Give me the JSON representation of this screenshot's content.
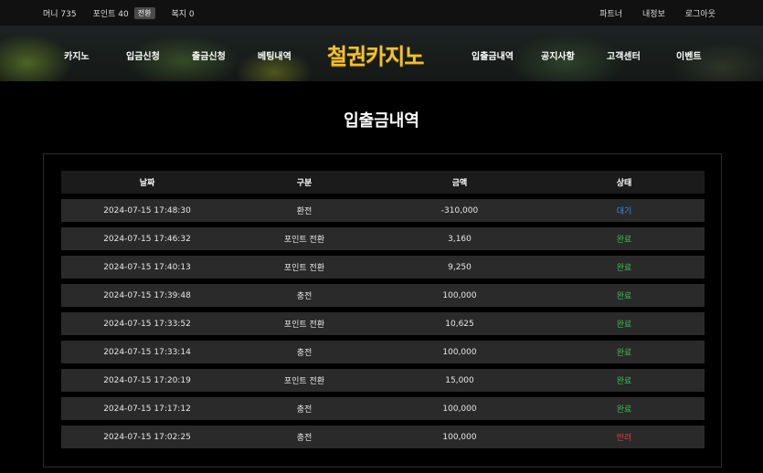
{
  "topbar": {
    "money_label": "머니 735",
    "point_label": "포인트 40",
    "convert_badge": "전환",
    "lottery_label": "복지 0",
    "links": [
      "파트너",
      "내정보",
      "로그아웃"
    ]
  },
  "nav": {
    "logo": "철권카지노",
    "left_items": [
      "카지노",
      "입금신청",
      "출금신청",
      "베팅내역"
    ],
    "right_items": [
      "입출금내역",
      "공지사항",
      "고객센터",
      "이벤트"
    ]
  },
  "page": {
    "title": "입출금내역"
  },
  "table": {
    "headers": [
      "날짜",
      "구분",
      "금액",
      "상태"
    ],
    "rows": [
      {
        "date": "2024-07-15 17:48:30",
        "type": "환전",
        "amount": "-310,000",
        "status": "대기",
        "status_kind": "wait"
      },
      {
        "date": "2024-07-15 17:46:32",
        "type": "포인트 전환",
        "amount": "3,160",
        "status": "완료",
        "status_kind": "done"
      },
      {
        "date": "2024-07-15 17:40:13",
        "type": "포인트 전환",
        "amount": "9,250",
        "status": "완료",
        "status_kind": "done"
      },
      {
        "date": "2024-07-15 17:39:48",
        "type": "충전",
        "amount": "100,000",
        "status": "완료",
        "status_kind": "done"
      },
      {
        "date": "2024-07-15 17:33:52",
        "type": "포인트 전환",
        "amount": "10,625",
        "status": "완료",
        "status_kind": "done"
      },
      {
        "date": "2024-07-15 17:33:14",
        "type": "충전",
        "amount": "100,000",
        "status": "완료",
        "status_kind": "done"
      },
      {
        "date": "2024-07-15 17:20:19",
        "type": "포인트 전환",
        "amount": "15,000",
        "status": "완료",
        "status_kind": "done"
      },
      {
        "date": "2024-07-15 17:17:12",
        "type": "충전",
        "amount": "100,000",
        "status": "완료",
        "status_kind": "done"
      },
      {
        "date": "2024-07-15 17:02:25",
        "type": "충전",
        "amount": "100,000",
        "status": "반려",
        "status_kind": "reject"
      }
    ]
  },
  "colors": {
    "logo": "#f2c12e",
    "status_wait": "#3b8fe0",
    "status_done": "#3fbf4a",
    "status_reject": "#e23b3b"
  }
}
